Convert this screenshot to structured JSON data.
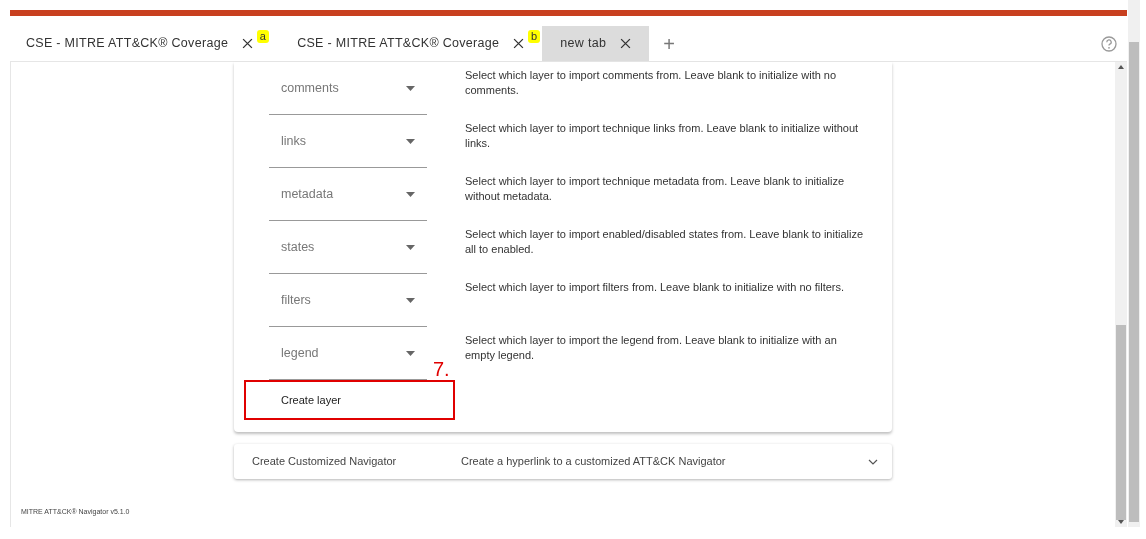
{
  "tabs": [
    {
      "label": "CSE - MITRE ATT&CK® Coverage",
      "selected": false,
      "badge": "a"
    },
    {
      "label": "CSE - MITRE ATT&CK® Coverage",
      "selected": false,
      "badge": "b"
    },
    {
      "label": "new tab",
      "selected": true
    }
  ],
  "add_tab": "+",
  "layer_fields": [
    {
      "placeholder": "comments",
      "description": "Select which layer to import comments from. Leave blank to initialize with no comments."
    },
    {
      "placeholder": "links",
      "description": "Select which layer to import technique links from. Leave blank to initialize without links."
    },
    {
      "placeholder": "metadata",
      "description": "Select which layer to import technique metadata from. Leave blank to initialize without metadata."
    },
    {
      "placeholder": "states",
      "description": "Select which layer to import enabled/disabled states from. Leave blank to initialize all to enabled."
    },
    {
      "placeholder": "filters",
      "description": "Select which layer to import filters from. Leave blank to initialize with no filters."
    },
    {
      "placeholder": "legend",
      "description": "Select which layer to import the legend from. Leave blank to initialize with an empty legend."
    }
  ],
  "create_button": {
    "label": "Create layer",
    "highlighted": true,
    "annotation": "7."
  },
  "panel": {
    "title": "Create Customized Navigator",
    "description": "Create a hyperlink to a customized ATT&CK Navigator",
    "expanded": false
  },
  "footer": "MITRE ATT&CK® Navigator v5.1.0"
}
